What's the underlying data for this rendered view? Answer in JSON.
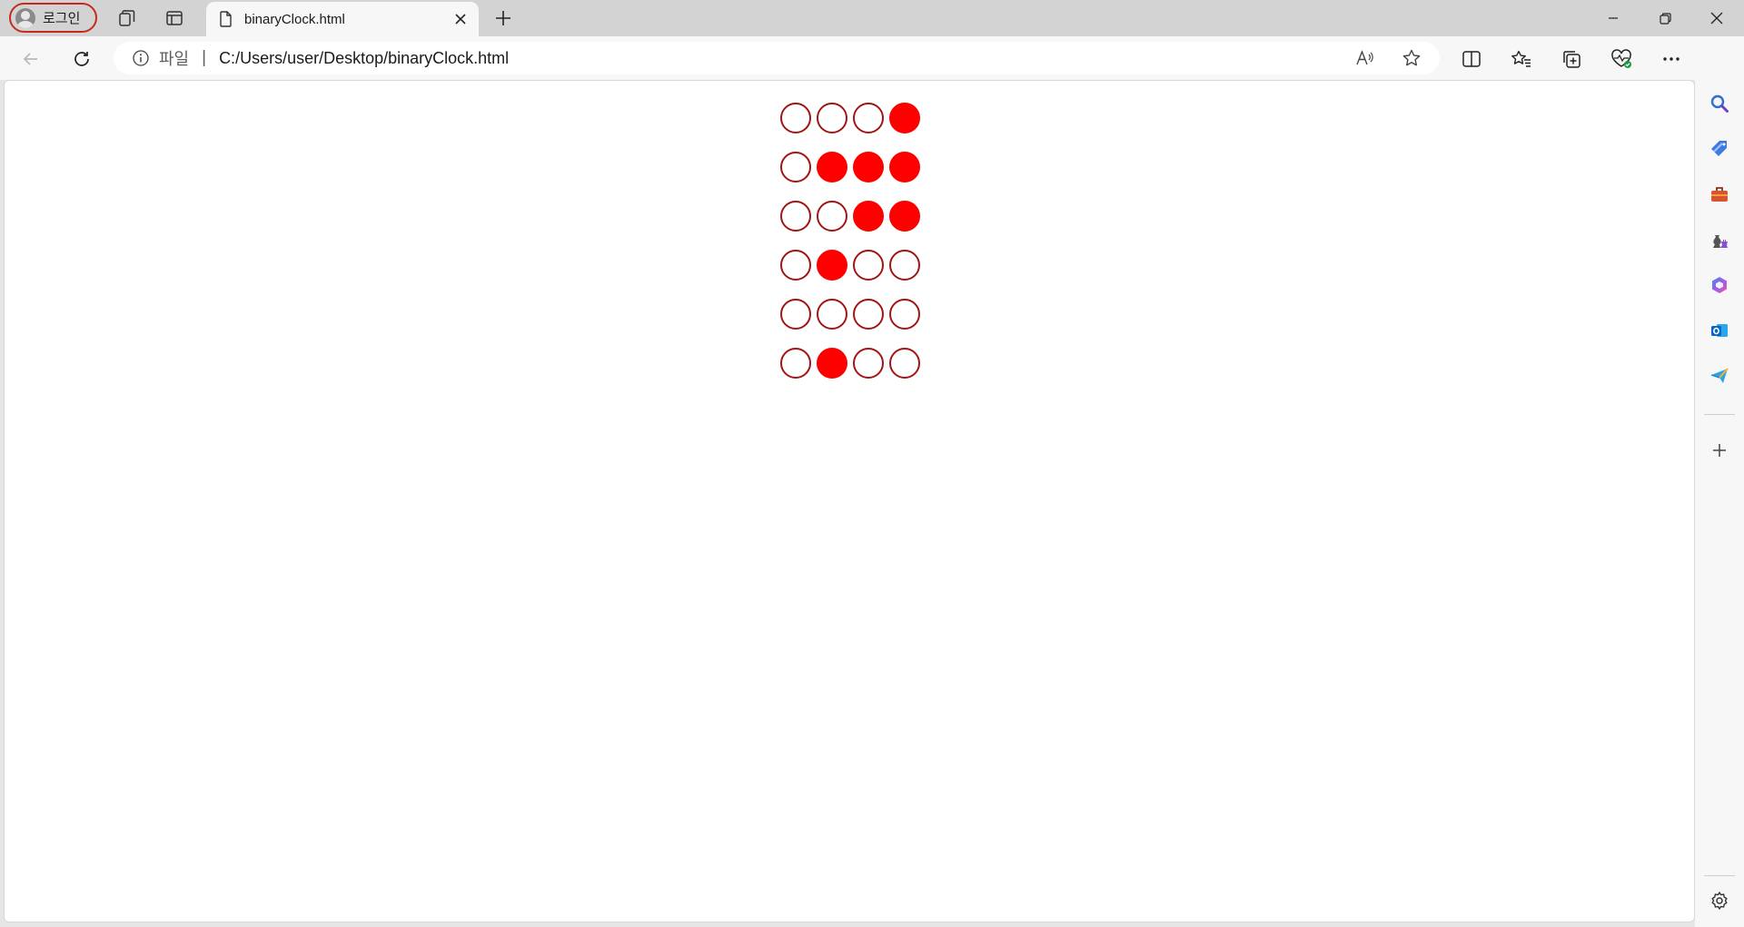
{
  "tabstrip": {
    "profile_label": "로그인",
    "tab_title": "binaryClock.html"
  },
  "toolbar": {
    "scheme_label": "파일",
    "separator": "|",
    "url": "C:/Users/user/Desktop/binaryClock.html"
  },
  "page": {
    "binary_clock": {
      "rows": [
        [
          0,
          0,
          0,
          1
        ],
        [
          0,
          1,
          1,
          1
        ],
        [
          0,
          0,
          1,
          1
        ],
        [
          0,
          1,
          0,
          0
        ],
        [
          0,
          0,
          0,
          0
        ],
        [
          0,
          1,
          0,
          0
        ]
      ],
      "on_color": "#ff0000",
      "off_border_color": "#a31515"
    }
  },
  "colors": {
    "profile_outline": "#c42b1c",
    "tabstrip_bg": "#d3d3d3",
    "toolbar_bg": "#f7f7f7"
  },
  "sidebar": {
    "icons": [
      "search-icon",
      "tag-icon",
      "toolbox-icon",
      "chess-icon",
      "office-icon",
      "outlook-icon",
      "send-icon",
      "add-icon",
      "settings-icon"
    ]
  }
}
